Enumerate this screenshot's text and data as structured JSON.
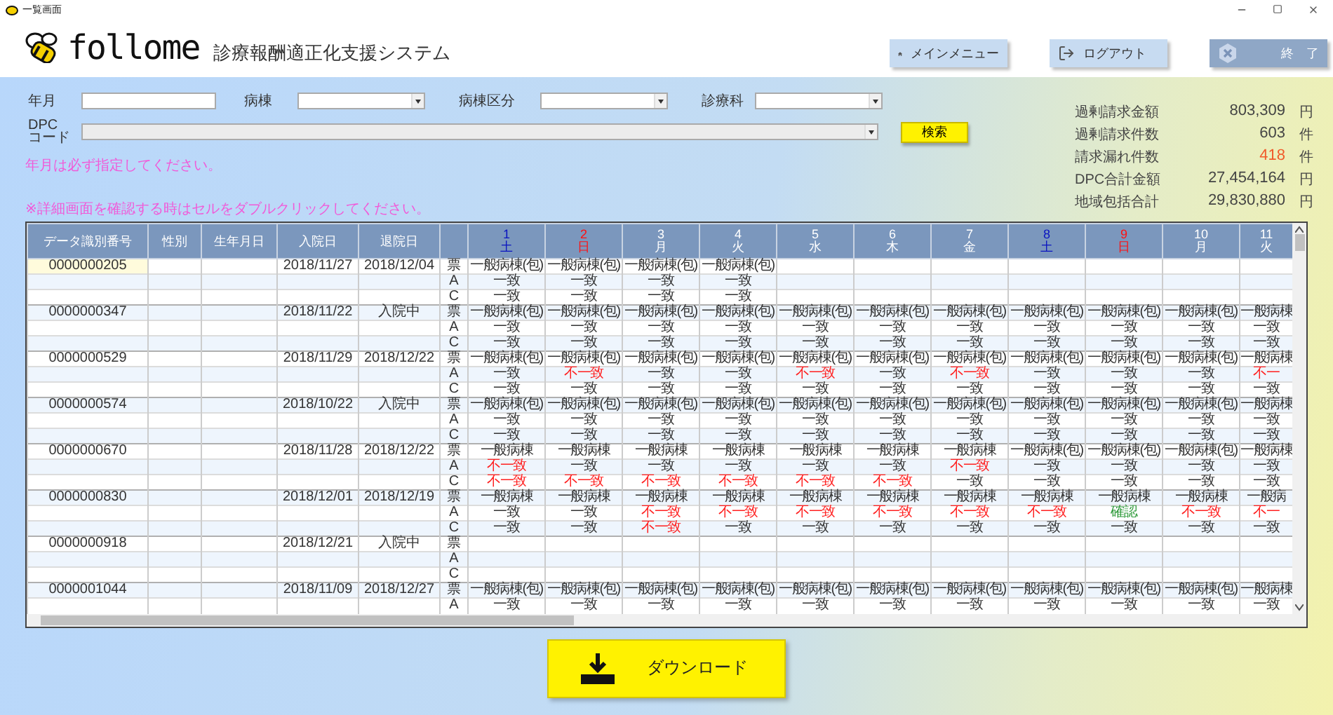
{
  "window": {
    "title": "一覧画面"
  },
  "app": {
    "logo": "follome",
    "subtitle": "診療報酬適正化支援システム"
  },
  "header_buttons": [
    {
      "label": "メインメニュー",
      "kind": "home"
    },
    {
      "label": "ログアウト",
      "kind": "logout"
    },
    {
      "label": "終　了",
      "kind": "exit"
    }
  ],
  "filters": [
    {
      "label": "年月",
      "kind": "input"
    },
    {
      "label": "病棟",
      "kind": "select"
    },
    {
      "label": "病棟区分",
      "kind": "select"
    },
    {
      "label": "診療科",
      "kind": "select"
    }
  ],
  "dpc": {
    "label_lines": [
      "DPC",
      "コード"
    ],
    "disabled": true
  },
  "search_button": "検索",
  "messages": [
    "年月は必ず指定してください。",
    "※詳細画面を確認する時はセルをダブルクリックしてください。"
  ],
  "stats": [
    {
      "label": "過剰請求金額",
      "value": "803,309",
      "unit": "円",
      "kind": "normal"
    },
    {
      "label": "過剰請求件数",
      "value": "603",
      "unit": "件",
      "kind": "normal"
    },
    {
      "label": "請求漏れ件数",
      "value": "418",
      "unit": "件",
      "kind": "alert"
    },
    {
      "label": "DPC合計金額",
      "value": "27,454,164",
      "unit": "円",
      "kind": "normal"
    },
    {
      "label": "地域包括合計",
      "value": "29,830,880",
      "unit": "円",
      "kind": "normal"
    }
  ],
  "table": {
    "columns": [
      "データ識別番号",
      "性別",
      "生年月日",
      "入院日",
      "退院日"
    ],
    "days": [
      {
        "day": "1",
        "weekday": "土",
        "kind": "sat"
      },
      {
        "day": "2",
        "weekday": "日",
        "kind": "sun"
      },
      {
        "day": "3",
        "weekday": "月",
        "kind": "weekday"
      },
      {
        "day": "4",
        "weekday": "火",
        "kind": "weekday"
      },
      {
        "day": "5",
        "weekday": "水",
        "kind": "weekday"
      },
      {
        "day": "6",
        "weekday": "木",
        "kind": "weekday"
      },
      {
        "day": "7",
        "weekday": "金",
        "kind": "weekday"
      },
      {
        "day": "8",
        "weekday": "土",
        "kind": "sat"
      },
      {
        "day": "9",
        "weekday": "日",
        "kind": "sun"
      },
      {
        "day": "10",
        "weekday": "月",
        "kind": "weekday"
      },
      {
        "day": "11",
        "weekday": "火",
        "kind": "weekday"
      }
    ],
    "patients": [
      {
        "id": "0000000205",
        "admitted": "2018/11/27",
        "discharged": "2018/12/04",
        "selected": true,
        "rows": [
          {
            "type": "票",
            "cells": [
              {
                "text": "一般病棟(包)",
                "kind": "ward"
              },
              {
                "text": "一般病棟(包)",
                "kind": "ward"
              },
              {
                "text": "一般病棟(包)",
                "kind": "ward"
              },
              {
                "text": "一般病棟(包)",
                "kind": "ward"
              }
            ]
          },
          {
            "type": "A",
            "cells": [
              {
                "text": "一致",
                "kind": "match"
              },
              {
                "text": "一致",
                "kind": "match"
              },
              {
                "text": "一致",
                "kind": "match"
              },
              {
                "text": "一致",
                "kind": "match"
              }
            ]
          },
          {
            "type": "C",
            "cells": [
              {
                "text": "一致",
                "kind": "match"
              },
              {
                "text": "一致",
                "kind": "match"
              },
              {
                "text": "一致",
                "kind": "match"
              },
              {
                "text": "一致",
                "kind": "match"
              }
            ]
          }
        ]
      },
      {
        "id": "0000000347",
        "admitted": "2018/11/22",
        "discharged": "入院中",
        "selected": false,
        "rows": [
          {
            "type": "票",
            "cells": [
              {
                "text": "一般病棟(包)",
                "kind": "ward"
              },
              {
                "text": "一般病棟(包)",
                "kind": "ward"
              },
              {
                "text": "一般病棟(包)",
                "kind": "ward"
              },
              {
                "text": "一般病棟(包)",
                "kind": "ward"
              },
              {
                "text": "一般病棟(包)",
                "kind": "ward"
              },
              {
                "text": "一般病棟(包)",
                "kind": "ward"
              },
              {
                "text": "一般病棟(包)",
                "kind": "ward"
              },
              {
                "text": "一般病棟(包)",
                "kind": "ward"
              },
              {
                "text": "一般病棟(包)",
                "kind": "ward"
              },
              {
                "text": "一般病棟(包)",
                "kind": "ward"
              },
              {
                "text": "一般病棟",
                "kind": "ward"
              }
            ]
          },
          {
            "type": "A",
            "cells": [
              {
                "text": "一致",
                "kind": "match"
              },
              {
                "text": "一致",
                "kind": "match"
              },
              {
                "text": "一致",
                "kind": "match"
              },
              {
                "text": "一致",
                "kind": "match"
              },
              {
                "text": "一致",
                "kind": "match"
              },
              {
                "text": "一致",
                "kind": "match"
              },
              {
                "text": "一致",
                "kind": "match"
              },
              {
                "text": "一致",
                "kind": "match"
              },
              {
                "text": "一致",
                "kind": "match"
              },
              {
                "text": "一致",
                "kind": "match"
              },
              {
                "text": "一致",
                "kind": "match"
              }
            ]
          },
          {
            "type": "C",
            "cells": [
              {
                "text": "一致",
                "kind": "match"
              },
              {
                "text": "一致",
                "kind": "match"
              },
              {
                "text": "一致",
                "kind": "match"
              },
              {
                "text": "一致",
                "kind": "match"
              },
              {
                "text": "一致",
                "kind": "match"
              },
              {
                "text": "一致",
                "kind": "match"
              },
              {
                "text": "一致",
                "kind": "match"
              },
              {
                "text": "一致",
                "kind": "match"
              },
              {
                "text": "一致",
                "kind": "match"
              },
              {
                "text": "一致",
                "kind": "match"
              },
              {
                "text": "一致",
                "kind": "match"
              }
            ]
          }
        ]
      },
      {
        "id": "0000000529",
        "admitted": "2018/11/29",
        "discharged": "2018/12/22",
        "selected": false,
        "rows": [
          {
            "type": "票",
            "cells": [
              {
                "text": "一般病棟(包)",
                "kind": "ward"
              },
              {
                "text": "一般病棟(包)",
                "kind": "ward"
              },
              {
                "text": "一般病棟(包)",
                "kind": "ward"
              },
              {
                "text": "一般病棟(包)",
                "kind": "ward"
              },
              {
                "text": "一般病棟(包)",
                "kind": "ward"
              },
              {
                "text": "一般病棟(包)",
                "kind": "ward"
              },
              {
                "text": "一般病棟(包)",
                "kind": "ward"
              },
              {
                "text": "一般病棟(包)",
                "kind": "ward"
              },
              {
                "text": "一般病棟(包)",
                "kind": "ward"
              },
              {
                "text": "一般病棟(包)",
                "kind": "ward"
              },
              {
                "text": "一般病棟",
                "kind": "ward"
              }
            ]
          },
          {
            "type": "A",
            "cells": [
              {
                "text": "一致",
                "kind": "match"
              },
              {
                "text": "不一致",
                "kind": "mismatch"
              },
              {
                "text": "一致",
                "kind": "match"
              },
              {
                "text": "一致",
                "kind": "match"
              },
              {
                "text": "不一致",
                "kind": "mismatch"
              },
              {
                "text": "一致",
                "kind": "match"
              },
              {
                "text": "不一致",
                "kind": "mismatch"
              },
              {
                "text": "一致",
                "kind": "match"
              },
              {
                "text": "一致",
                "kind": "match"
              },
              {
                "text": "一致",
                "kind": "match"
              },
              {
                "text": "不一",
                "kind": "mismatch"
              }
            ]
          },
          {
            "type": "C",
            "cells": [
              {
                "text": "一致",
                "kind": "match"
              },
              {
                "text": "一致",
                "kind": "match"
              },
              {
                "text": "一致",
                "kind": "match"
              },
              {
                "text": "一致",
                "kind": "match"
              },
              {
                "text": "一致",
                "kind": "match"
              },
              {
                "text": "一致",
                "kind": "match"
              },
              {
                "text": "一致",
                "kind": "match"
              },
              {
                "text": "一致",
                "kind": "match"
              },
              {
                "text": "一致",
                "kind": "match"
              },
              {
                "text": "一致",
                "kind": "match"
              },
              {
                "text": "一致",
                "kind": "match"
              }
            ]
          }
        ]
      },
      {
        "id": "0000000574",
        "admitted": "2018/10/22",
        "discharged": "入院中",
        "selected": false,
        "rows": [
          {
            "type": "票",
            "cells": [
              {
                "text": "一般病棟(包)",
                "kind": "ward"
              },
              {
                "text": "一般病棟(包)",
                "kind": "ward"
              },
              {
                "text": "一般病棟(包)",
                "kind": "ward"
              },
              {
                "text": "一般病棟(包)",
                "kind": "ward"
              },
              {
                "text": "一般病棟(包)",
                "kind": "ward"
              },
              {
                "text": "一般病棟(包)",
                "kind": "ward"
              },
              {
                "text": "一般病棟(包)",
                "kind": "ward"
              },
              {
                "text": "一般病棟(包)",
                "kind": "ward"
              },
              {
                "text": "一般病棟(包)",
                "kind": "ward"
              },
              {
                "text": "一般病棟(包)",
                "kind": "ward"
              },
              {
                "text": "一般病棟",
                "kind": "ward"
              }
            ]
          },
          {
            "type": "A",
            "cells": [
              {
                "text": "一致",
                "kind": "match"
              },
              {
                "text": "一致",
                "kind": "match"
              },
              {
                "text": "一致",
                "kind": "match"
              },
              {
                "text": "一致",
                "kind": "match"
              },
              {
                "text": "一致",
                "kind": "match"
              },
              {
                "text": "一致",
                "kind": "match"
              },
              {
                "text": "一致",
                "kind": "match"
              },
              {
                "text": "一致",
                "kind": "match"
              },
              {
                "text": "一致",
                "kind": "match"
              },
              {
                "text": "一致",
                "kind": "match"
              },
              {
                "text": "一致",
                "kind": "match"
              }
            ]
          },
          {
            "type": "C",
            "cells": [
              {
                "text": "一致",
                "kind": "match"
              },
              {
                "text": "一致",
                "kind": "match"
              },
              {
                "text": "一致",
                "kind": "match"
              },
              {
                "text": "一致",
                "kind": "match"
              },
              {
                "text": "一致",
                "kind": "match"
              },
              {
                "text": "一致",
                "kind": "match"
              },
              {
                "text": "一致",
                "kind": "match"
              },
              {
                "text": "一致",
                "kind": "match"
              },
              {
                "text": "一致",
                "kind": "match"
              },
              {
                "text": "一致",
                "kind": "match"
              },
              {
                "text": "一致",
                "kind": "match"
              }
            ]
          }
        ]
      },
      {
        "id": "0000000670",
        "admitted": "2018/11/28",
        "discharged": "2018/12/22",
        "selected": false,
        "rows": [
          {
            "type": "票",
            "cells": [
              {
                "text": "一般病棟",
                "kind": "ward"
              },
              {
                "text": "一般病棟",
                "kind": "ward"
              },
              {
                "text": "一般病棟",
                "kind": "ward"
              },
              {
                "text": "一般病棟",
                "kind": "ward"
              },
              {
                "text": "一般病棟",
                "kind": "ward"
              },
              {
                "text": "一般病棟",
                "kind": "ward"
              },
              {
                "text": "一般病棟",
                "kind": "ward"
              },
              {
                "text": "一般病棟(包)",
                "kind": "ward"
              },
              {
                "text": "一般病棟(包)",
                "kind": "ward"
              },
              {
                "text": "一般病棟(包)",
                "kind": "ward"
              },
              {
                "text": "一般病棟",
                "kind": "ward"
              }
            ]
          },
          {
            "type": "A",
            "cells": [
              {
                "text": "不一致",
                "kind": "mismatch"
              },
              {
                "text": "一致",
                "kind": "match"
              },
              {
                "text": "一致",
                "kind": "match"
              },
              {
                "text": "一致",
                "kind": "match"
              },
              {
                "text": "一致",
                "kind": "match"
              },
              {
                "text": "一致",
                "kind": "match"
              },
              {
                "text": "不一致",
                "kind": "mismatch"
              },
              {
                "text": "一致",
                "kind": "match"
              },
              {
                "text": "一致",
                "kind": "match"
              },
              {
                "text": "一致",
                "kind": "match"
              },
              {
                "text": "一致",
                "kind": "match"
              }
            ]
          },
          {
            "type": "C",
            "cells": [
              {
                "text": "不一致",
                "kind": "mismatch"
              },
              {
                "text": "不一致",
                "kind": "mismatch"
              },
              {
                "text": "不一致",
                "kind": "mismatch"
              },
              {
                "text": "不一致",
                "kind": "mismatch"
              },
              {
                "text": "不一致",
                "kind": "mismatch"
              },
              {
                "text": "不一致",
                "kind": "mismatch"
              },
              {
                "text": "一致",
                "kind": "match"
              },
              {
                "text": "一致",
                "kind": "match"
              },
              {
                "text": "一致",
                "kind": "match"
              },
              {
                "text": "一致",
                "kind": "match"
              },
              {
                "text": "一致",
                "kind": "match"
              }
            ]
          }
        ]
      },
      {
        "id": "0000000830",
        "admitted": "2018/12/01",
        "discharged": "2018/12/19",
        "selected": false,
        "rows": [
          {
            "type": "票",
            "cells": [
              {
                "text": "一般病棟",
                "kind": "ward"
              },
              {
                "text": "一般病棟",
                "kind": "ward"
              },
              {
                "text": "一般病棟",
                "kind": "ward"
              },
              {
                "text": "一般病棟",
                "kind": "ward"
              },
              {
                "text": "一般病棟",
                "kind": "ward"
              },
              {
                "text": "一般病棟",
                "kind": "ward"
              },
              {
                "text": "一般病棟",
                "kind": "ward"
              },
              {
                "text": "一般病棟",
                "kind": "ward"
              },
              {
                "text": "一般病棟",
                "kind": "ward"
              },
              {
                "text": "一般病棟",
                "kind": "ward"
              },
              {
                "text": "一般病",
                "kind": "ward"
              }
            ]
          },
          {
            "type": "A",
            "cells": [
              {
                "text": "一致",
                "kind": "match"
              },
              {
                "text": "一致",
                "kind": "match"
              },
              {
                "text": "不一致",
                "kind": "mismatch"
              },
              {
                "text": "不一致",
                "kind": "mismatch"
              },
              {
                "text": "不一致",
                "kind": "mismatch"
              },
              {
                "text": "不一致",
                "kind": "mismatch"
              },
              {
                "text": "不一致",
                "kind": "mismatch"
              },
              {
                "text": "不一致",
                "kind": "mismatch"
              },
              {
                "text": "確認",
                "kind": "confirmed"
              },
              {
                "text": "不一致",
                "kind": "mismatch"
              },
              {
                "text": "不一",
                "kind": "mismatch"
              }
            ]
          },
          {
            "type": "C",
            "cells": [
              {
                "text": "一致",
                "kind": "match"
              },
              {
                "text": "一致",
                "kind": "match"
              },
              {
                "text": "不一致",
                "kind": "mismatch"
              },
              {
                "text": "一致",
                "kind": "match"
              },
              {
                "text": "一致",
                "kind": "match"
              },
              {
                "text": "一致",
                "kind": "match"
              },
              {
                "text": "一致",
                "kind": "match"
              },
              {
                "text": "一致",
                "kind": "match"
              },
              {
                "text": "一致",
                "kind": "match"
              },
              {
                "text": "一致",
                "kind": "match"
              },
              {
                "text": "一致",
                "kind": "match"
              }
            ]
          }
        ]
      },
      {
        "id": "0000000918",
        "admitted": "2018/12/21",
        "discharged": "入院中",
        "selected": false,
        "rows": [
          {
            "type": "票",
            "cells": []
          },
          {
            "type": "A",
            "cells": []
          },
          {
            "type": "C",
            "cells": []
          }
        ]
      },
      {
        "id": "0000001044",
        "admitted": "2018/11/09",
        "discharged": "2018/12/27",
        "selected": false,
        "rows": [
          {
            "type": "票",
            "cells": [
              {
                "text": "一般病棟(包)",
                "kind": "ward"
              },
              {
                "text": "一般病棟(包)",
                "kind": "ward"
              },
              {
                "text": "一般病棟(包)",
                "kind": "ward"
              },
              {
                "text": "一般病棟(包)",
                "kind": "ward"
              },
              {
                "text": "一般病棟(包)",
                "kind": "ward"
              },
              {
                "text": "一般病棟(包)",
                "kind": "ward"
              },
              {
                "text": "一般病棟(包)",
                "kind": "ward"
              },
              {
                "text": "一般病棟(包)",
                "kind": "ward"
              },
              {
                "text": "一般病棟(包)",
                "kind": "ward"
              },
              {
                "text": "一般病棟(包)",
                "kind": "ward"
              },
              {
                "text": "一般病棟",
                "kind": "ward"
              }
            ]
          },
          {
            "type": "A",
            "cells": [
              {
                "text": "一致",
                "kind": "match"
              },
              {
                "text": "一致",
                "kind": "match"
              },
              {
                "text": "一致",
                "kind": "match"
              },
              {
                "text": "一致",
                "kind": "match"
              },
              {
                "text": "一致",
                "kind": "match"
              },
              {
                "text": "一致",
                "kind": "match"
              },
              {
                "text": "一致",
                "kind": "match"
              },
              {
                "text": "一致",
                "kind": "match"
              },
              {
                "text": "一致",
                "kind": "match"
              },
              {
                "text": "一致",
                "kind": "match"
              },
              {
                "text": "一致",
                "kind": "match"
              }
            ]
          }
        ]
      }
    ]
  },
  "download_button": "ダウンロード"
}
